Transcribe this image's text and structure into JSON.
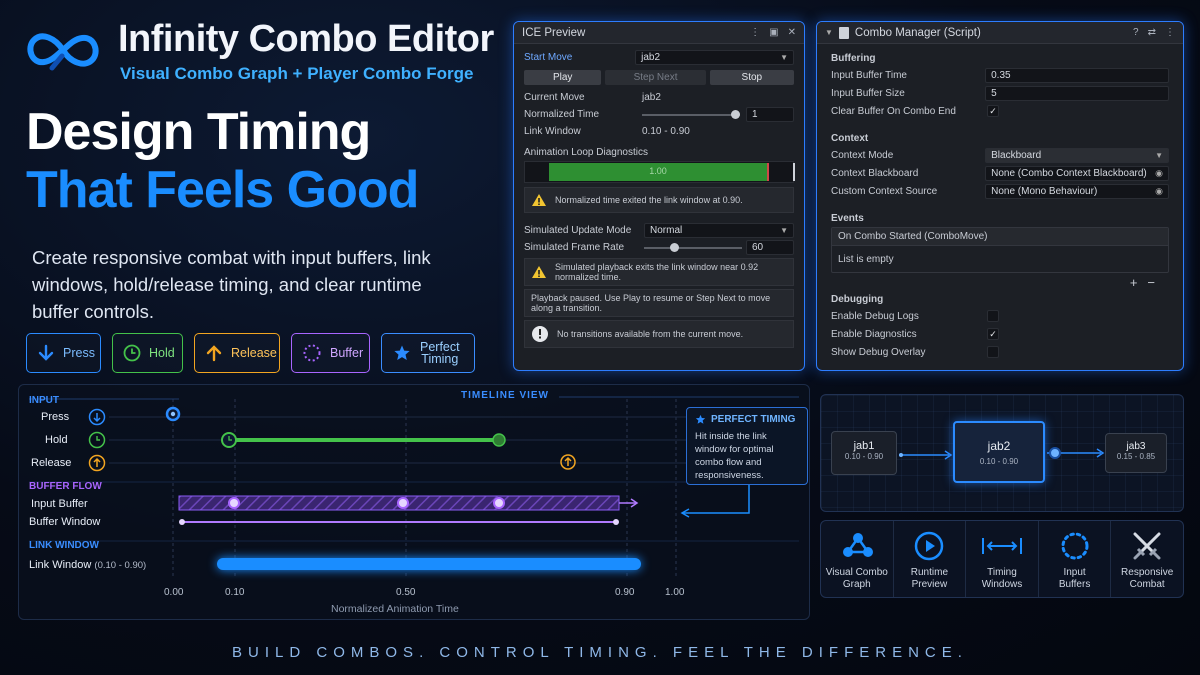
{
  "app": {
    "title": "Infinity Combo Editor",
    "subtitle": "Visual Combo Graph + Player Combo Forge"
  },
  "hero": {
    "line1": "Design Timing",
    "line2": "That Feels Good",
    "description": "Create responsive combat with input buffers, link windows, hold/release timing, and clear runtime buffer controls."
  },
  "chips": {
    "press": "Press",
    "hold": "Hold",
    "release": "Release",
    "buffer": "Buffer",
    "perfect_line1": "Perfect",
    "perfect_line2": "Timing"
  },
  "preview": {
    "title": "ICE Preview",
    "start_move_label": "Start Move",
    "start_move_value": "jab2",
    "play": "Play",
    "step_next": "Step Next",
    "stop": "Stop",
    "current_move_label": "Current Move",
    "current_move_value": "jab2",
    "normalized_time_label": "Normalized Time",
    "normalized_time_value": "1",
    "normalized_time_fraction": 1.0,
    "link_window_label": "Link Window",
    "link_window_value": "0.10 - 0.90",
    "diagnostics_header": "Animation Loop Diagnostics",
    "diagnostics_bar_value": "1.00",
    "warn1": "Normalized time exited the link window at 0.90.",
    "sim_mode_label": "Simulated Update Mode",
    "sim_mode_value": "Normal",
    "sim_rate_label": "Simulated Frame Rate",
    "sim_rate_value": "60",
    "warn2": "Simulated playback exits the link window near 0.92 normalized time.",
    "paused_msg": "Playback paused. Use Play to resume or Step Next to move along a transition.",
    "info_msg": "No transitions available from the current move."
  },
  "manager": {
    "title": "Combo Manager (Script)",
    "buffering_header": "Buffering",
    "input_buffer_time_label": "Input Buffer Time",
    "input_buffer_time_value": "0.35",
    "input_buffer_size_label": "Input Buffer Size",
    "input_buffer_size_value": "5",
    "clear_buffer_label": "Clear Buffer On Combo End",
    "clear_buffer_checked": true,
    "context_header": "Context",
    "context_mode_label": "Context Mode",
    "context_mode_value": "Blackboard",
    "context_blackboard_label": "Context Blackboard",
    "context_blackboard_value": "None (Combo Context Blackboard)",
    "custom_source_label": "Custom Context Source",
    "custom_source_value": "None (Mono Behaviour)",
    "events_header": "Events",
    "event_name": "On Combo Started (ComboMove)",
    "event_list": "List is empty",
    "debugging_header": "Debugging",
    "debug_logs_label": "Enable Debug Logs",
    "debug_logs_checked": false,
    "diagnostics_label": "Enable Diagnostics",
    "diagnostics_checked": true,
    "overlay_label": "Show Debug Overlay",
    "overlay_checked": false
  },
  "timeline": {
    "view_label": "TIMELINE VIEW",
    "input_section": "INPUT",
    "press": "Press",
    "hold": "Hold",
    "release": "Release",
    "buffer_section": "BUFFER FLOW",
    "input_buffer": "Input Buffer",
    "buffer_window": "Buffer Window",
    "link_section": "LINK WINDOW",
    "link_window": "Link Window",
    "link_window_range": "(0.10 - 0.90)",
    "ticks": [
      "0.00",
      "0.10",
      "0.50",
      "0.90",
      "1.00"
    ],
    "axis_label": "Normalized Animation Time",
    "perfect_title": "PERFECT TIMING",
    "perfect_body": "Hit inside the link window for optimal combo flow and responsiveness."
  },
  "graph": {
    "nodes": [
      {
        "name": "jab1",
        "range": "0.10 - 0.90"
      },
      {
        "name": "jab2",
        "range": "0.10 - 0.90"
      },
      {
        "name": "jab3",
        "range": "0.15 - 0.85"
      }
    ]
  },
  "features": {
    "f1a": "Visual Combo",
    "f1b": "Graph",
    "f2a": "Runtime",
    "f2b": "Preview",
    "f3a": "Timing",
    "f3b": "Windows",
    "f4a": "Input",
    "f4b": "Buffers",
    "f5a": "Responsive",
    "f5b": "Combat"
  },
  "tagline": "BUILD COMBOS. CONTROL TIMING. FEEL THE DIFFERENCE.",
  "colors": {
    "accent_blue": "#1a8dff",
    "hold_green": "#44c24a",
    "release_orange": "#f2a521",
    "buffer_purple": "#a865ff"
  }
}
